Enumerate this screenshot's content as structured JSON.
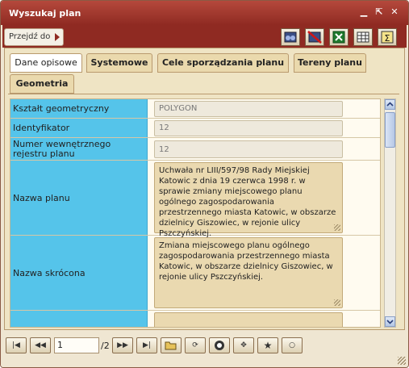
{
  "window": {
    "title": "Wyszukaj plan"
  },
  "toolbar": {
    "goto_label": "Przejdź do"
  },
  "tabs": [
    {
      "label": "Dane opisowe",
      "active": true
    },
    {
      "label": "Systemowe",
      "active": false
    },
    {
      "label": "Cele sporządzania planu",
      "active": false
    },
    {
      "label": "Tereny planu",
      "active": false
    },
    {
      "label": "Geometria",
      "active": false
    }
  ],
  "rows": [
    {
      "label": "Kształt geometryczny",
      "value": "POLYGON"
    },
    {
      "label": "Identyfikator",
      "value": "12"
    },
    {
      "label": "Numer wewnętrznego rejestru planu",
      "value": "12"
    },
    {
      "label": "Nazwa planu",
      "value": "Uchwała nr LIII/597/98 Rady Miejskiej Katowic z dnia 19 czerwca 1998 r. w sprawie zmiany miejscowego planu ogólnego zagospodarowania przestrzennego miasta Katowic, w obszarze dzielnicy Giszowiec, w rejonie ulicy Pszczyńskiej."
    },
    {
      "label": "Nazwa skrócona",
      "value": "Zmiana miejscowego planu ogólnego zagospodarowania przestrzennego miasta Katowic, w obszarze dzielnicy Giszowiec, w rejonie ulicy Pszczyńskiej."
    }
  ],
  "pager": {
    "current": "1",
    "total": "/2"
  }
}
